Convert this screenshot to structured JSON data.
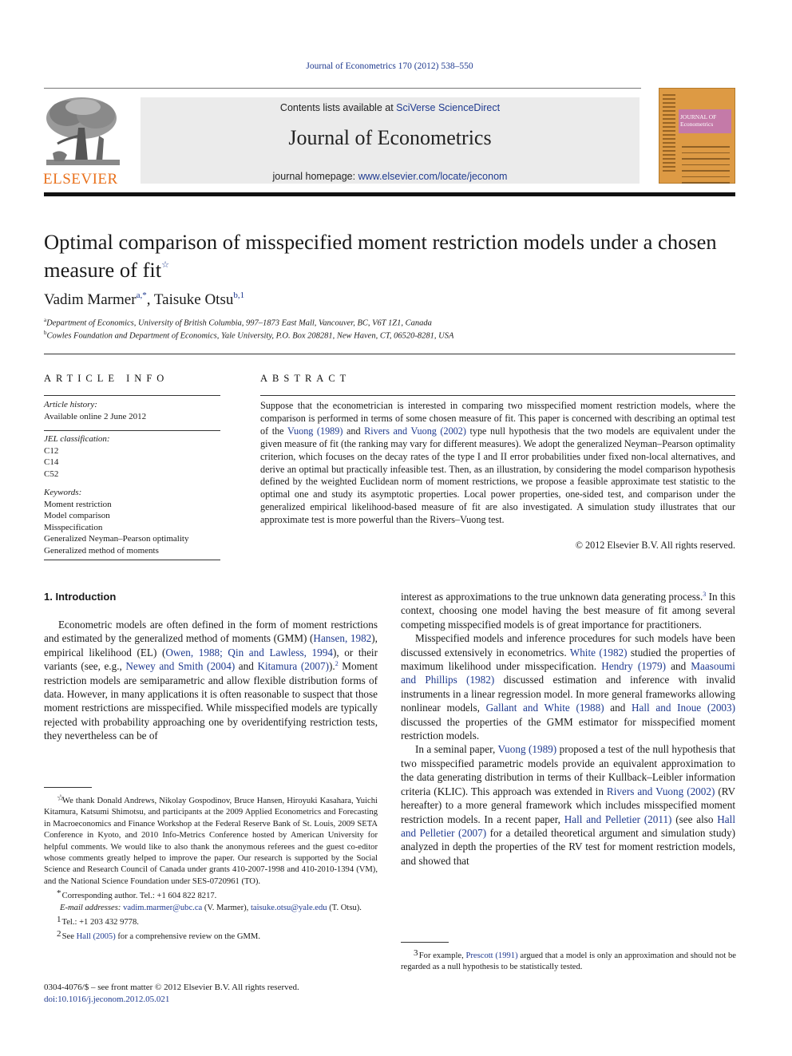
{
  "header": {
    "journal_ref": "Journal of Econometrics 170 (2012) 538–550",
    "contents_prefix": "Contents lists available at ",
    "contents_link": "SciVerse ScienceDirect",
    "journal_title": "Journal of Econometrics",
    "homepage_prefix": "journal homepage: ",
    "homepage_link": "www.elsevier.com/locate/jeconom",
    "publisher_logo_text": "ELSEVIER",
    "cover_title_line1": "JOURNAL OF",
    "cover_title_line2": "Econometrics",
    "colors": {
      "publisher_orange": "#e9711c",
      "link_blue": "#1f3a8f",
      "band_gray": "#ebebeb",
      "cover_orange": "#dd9a44",
      "cover_panel": "#c47aa8"
    }
  },
  "article": {
    "title": "Optimal comparison of misspecified moment restriction models under a chosen measure of fit",
    "title_note_mark": "☆",
    "authors": [
      {
        "name": "Vadim Marmer",
        "marks": "a,*"
      },
      {
        "name": "Taisuke Otsu",
        "marks": "b,1"
      }
    ],
    "author_separator": ", ",
    "affiliations": [
      {
        "mark": "a",
        "text": "Department of Economics, University of British Columbia, 997–1873 East Mall, Vancouver, BC, V6T 1Z1, Canada"
      },
      {
        "mark": "b",
        "text": "Cowles Foundation and Department of Economics, Yale University, P.O. Box 208281, New Haven, CT, 06520-8281, USA"
      }
    ]
  },
  "article_info": {
    "heading": "ARTICLE INFO",
    "history_label": "Article history:",
    "history_value": "Available online 2 June 2012",
    "jel_label": "JEL classification:",
    "jel_codes": [
      "C12",
      "C14",
      "C52"
    ],
    "keywords_label": "Keywords:",
    "keywords": [
      "Moment restriction",
      "Model comparison",
      "Misspecification",
      "Generalized Neyman–Pearson optimality",
      "Generalized method of moments"
    ]
  },
  "abstract": {
    "heading": "ABSTRACT",
    "p1": "Suppose that the econometrician is interested in comparing two misspecified moment restriction models, where the comparison is performed in terms of some chosen measure of fit. This paper is concerned with describing an optimal test of the ",
    "ref1": "Vuong (1989)",
    "p2": " and ",
    "ref2": "Rivers and Vuong (2002)",
    "p3": " type null hypothesis that the two models are equivalent under the given measure of fit (the ranking may vary for different measures). We adopt the generalized Neyman–Pearson optimality criterion, which focuses on the decay rates of the type I and II error probabilities under fixed non-local alternatives, and derive an optimal but practically infeasible test. Then, as an illustration, by considering the model comparison hypothesis defined by the weighted Euclidean norm of moment restrictions, we propose a feasible approximate test statistic to the optimal one and study its asymptotic properties. Local power properties, one-sided test, and comparison under the generalized empirical likelihood-based measure of fit are also investigated. A simulation study illustrates that our approximate test is more powerful than the Rivers–Vuong test.",
    "copyright": "© 2012 Elsevier B.V. All rights reserved."
  },
  "intro": {
    "heading": "1.  Introduction",
    "left": {
      "t1": "Econometric models are often defined in the form of moment restrictions and estimated by the generalized method of moments (GMM) (",
      "r1": "Hansen, 1982",
      "t2": "), empirical likelihood (EL) (",
      "r2": "Owen, 1988; Qin and Lawless, 1994",
      "t3": "), or their variants (see, e.g., ",
      "r3": "Newey and Smith (2004)",
      "t4": " and ",
      "r4": "Kitamura (2007)",
      "t5": ").",
      "fn_mark": "2",
      "t6": " Moment restriction models are semiparametric and allow flexible distribution forms of data. However, in many applications it is often reasonable to suspect that those moment restrictions are misspecified. While misspecified models are typically rejected with probability approaching one by overidentifying restriction tests, they nevertheless can be of"
    },
    "right": {
      "p1_t1": "interest as approximations to the true unknown data generating process.",
      "p1_fn": "3",
      "p1_t2": " In this context, choosing one model having the best measure of fit among several competing misspecified models is of great importance for practitioners.",
      "p2_t1": "Misspecified models and inference procedures for such models have been discussed extensively in econometrics. ",
      "p2_r1": "White (1982)",
      "p2_t2": " studied the properties of maximum likelihood under misspecification. ",
      "p2_r2": "Hendry (1979)",
      "p2_t3": " and ",
      "p2_r3": "Maasoumi and Phillips (1982)",
      "p2_t4": " discussed estimation and inference with invalid instruments in a linear regression model. In more general frameworks allowing nonlinear models, ",
      "p2_r4": "Gallant and White (1988)",
      "p2_t5": " and ",
      "p2_r5": "Hall and Inoue (2003)",
      "p2_t6": " discussed the properties of the GMM estimator for misspecified moment restriction models.",
      "p3_t1": "In a seminal paper, ",
      "p3_r1": "Vuong (1989)",
      "p3_t2": " proposed a test of the null hypothesis that two misspecified parametric models provide an equivalent approximation to the data generating distribution in terms of their Kullback–Leibler information criteria (KLIC). This approach was extended in ",
      "p3_r2": "Rivers and Vuong (2002)",
      "p3_t3": " (RV hereafter) to a more general framework which includes misspecified moment restriction models. In a recent paper, ",
      "p3_r3": "Hall and Pelletier (2011)",
      "p3_t4": " (see also ",
      "p3_r4": "Hall and Pelletier (2007)",
      "p3_t5": " for a detailed theoretical argument and simulation study) analyzed in depth the properties of the RV test for moment restriction models, and showed that"
    }
  },
  "footnotes": {
    "star_mark": "☆",
    "star_text": "We thank Donald Andrews, Nikolay Gospodinov, Bruce Hansen, Hiroyuki Kasahara, Yuichi Kitamura, Katsumi Shimotsu, and participants at the 2009 Applied Econometrics and Forecasting in Macroeconomics and Finance Workshop at the Federal Reserve Bank of St. Louis, 2009 SETA Conference in Kyoto, and 2010 Info-Metrics Conference hosted by American University for helpful comments. We would like to also thank the anonymous referees and the guest co-editor whose comments greatly helped to improve the paper. Our research is supported by the Social Science and Research Council of Canada under grants 410-2007-1998 and 410-2010-1394 (VM), and the National Science Foundation under SES-0720961 (TO).",
    "corr_mark": "*",
    "corr_text": "Corresponding author. Tel.: +1 604 822 8217.",
    "email_label": "E-mail addresses: ",
    "email1": "vadim.marmer@ubc.ca",
    "email1_who": " (V. Marmer), ",
    "email2": "taisuke.otsu@yale.edu",
    "email2_who": " (T. Otsu).",
    "fn1_mark": "1",
    "fn1_text": "Tel.: +1 203 432 9778.",
    "fn2_mark": "2",
    "fn2_t1": "See ",
    "fn2_ref": "Hall (2005)",
    "fn2_t2": " for a comprehensive review on the GMM.",
    "fn3_mark": "3",
    "fn3_t1": "For example, ",
    "fn3_ref": "Prescott (1991)",
    "fn3_t2": " argued that a model is only an approximation and should not be regarded as a null hypothesis to be statistically tested."
  },
  "front_matter": {
    "issn_line": "0304-4076/$ – see front matter © 2012 Elsevier B.V. All rights reserved.",
    "doi": "doi:10.1016/j.jeconom.2012.05.021"
  }
}
